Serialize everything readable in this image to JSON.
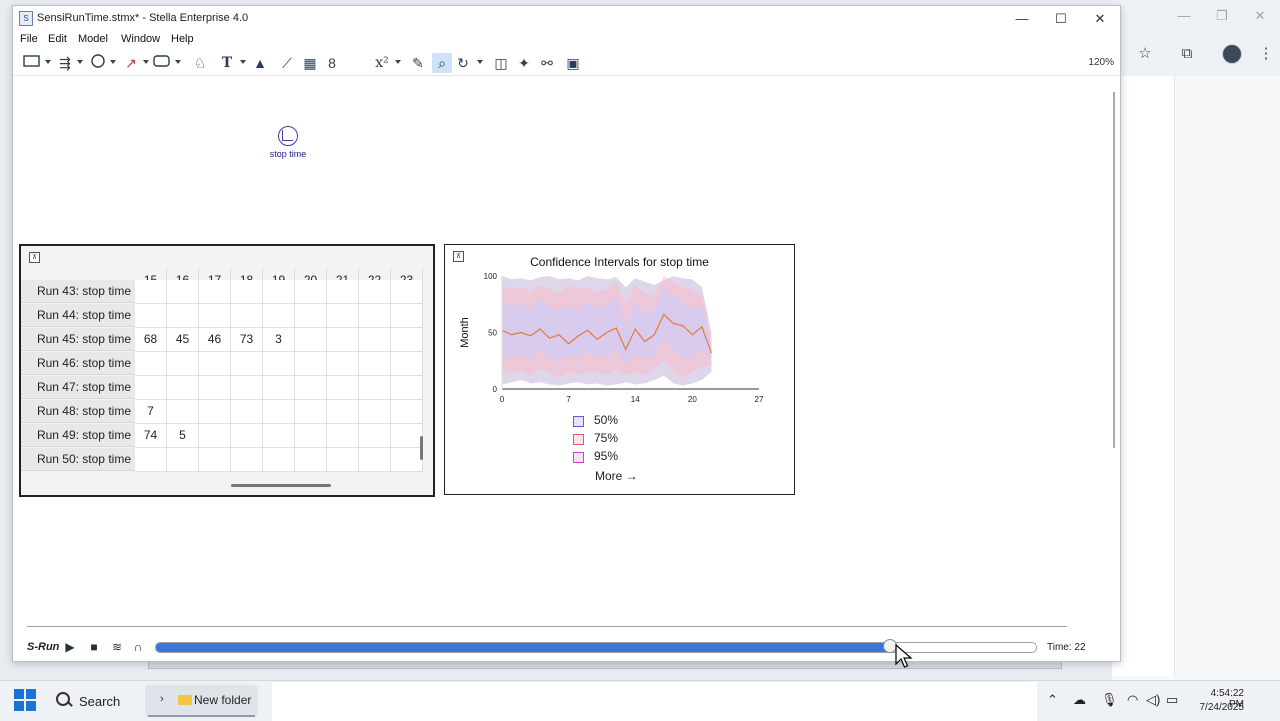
{
  "window": {
    "title": "SensiRunTime.stmx* - Stella Enterprise 4.0",
    "controls": {
      "minimize": "—",
      "maximize": "☐",
      "close": "✕"
    }
  },
  "menu": [
    "File",
    "Edit",
    "Model",
    "Window",
    "Help"
  ],
  "toolbar": {
    "zoom": "120%"
  },
  "canvas": {
    "converter_label": "stop time"
  },
  "table": {
    "columns": [
      "15",
      "16",
      "17",
      "18",
      "19",
      "20",
      "21",
      "22",
      "23"
    ],
    "rows": [
      {
        "label": "Run 43: stop time",
        "cells": [
          "",
          "",
          "",
          "",
          "",
          "",
          "",
          "",
          ""
        ]
      },
      {
        "label": "Run 44: stop time",
        "cells": [
          "",
          "",
          "",
          "",
          "",
          "",
          "",
          "",
          ""
        ]
      },
      {
        "label": "Run 45: stop time",
        "cells": [
          "68",
          "45",
          "46",
          "73",
          "3",
          "",
          "",
          "",
          ""
        ]
      },
      {
        "label": "Run 46: stop time",
        "cells": [
          "",
          "",
          "",
          "",
          "",
          "",
          "",
          "",
          ""
        ]
      },
      {
        "label": "Run 47: stop time",
        "cells": [
          "",
          "",
          "",
          "",
          "",
          "",
          "",
          "",
          ""
        ]
      },
      {
        "label": "Run 48: stop time",
        "cells": [
          "7",
          "",
          "",
          "",
          "",
          "",
          "",
          "",
          ""
        ]
      },
      {
        "label": "Run 49: stop time",
        "cells": [
          "74",
          "5",
          "",
          "",
          "",
          "",
          "",
          "",
          ""
        ]
      },
      {
        "label": "Run 50: stop time",
        "cells": [
          "",
          "",
          "",
          "",
          "",
          "",
          "",
          "",
          ""
        ]
      }
    ]
  },
  "chart": {
    "title": "Confidence Intervals for stop time",
    "ylabel": "Month",
    "legend": [
      {
        "label": "50%",
        "color": "#6a5acd"
      },
      {
        "label": "75%",
        "color": "#e05a6a"
      },
      {
        "label": "95%",
        "color": "#d040c8"
      }
    ],
    "more": "More →"
  },
  "chart_data": {
    "type": "area",
    "title": "Confidence Intervals for stop time",
    "ylabel": "Month",
    "xlim": [
      0,
      27
    ],
    "ylim": [
      0,
      100
    ],
    "xticks": [
      0,
      7,
      14,
      20,
      27
    ],
    "yticks": [
      0,
      50,
      100
    ],
    "x": [
      0,
      1,
      2,
      3,
      4,
      5,
      6,
      7,
      8,
      9,
      10,
      11,
      12,
      13,
      14,
      15,
      16,
      17,
      18,
      19,
      20,
      21,
      22
    ],
    "median": [
      52,
      48,
      50,
      47,
      53,
      45,
      48,
      40,
      47,
      52,
      44,
      50,
      54,
      35,
      53,
      42,
      48,
      66,
      58,
      56,
      48,
      55,
      32
    ],
    "band_95": {
      "low": [
        4,
        6,
        8,
        5,
        6,
        4,
        3,
        5,
        6,
        4,
        5,
        3,
        4,
        6,
        4,
        5,
        8,
        12,
        5,
        3,
        5,
        8,
        15
      ],
      "high": [
        100,
        97,
        98,
        96,
        99,
        100,
        97,
        98,
        96,
        100,
        98,
        97,
        99,
        90,
        98,
        95,
        92,
        96,
        100,
        98,
        97,
        90,
        50
      ]
    },
    "band_75": {
      "low": [
        15,
        14,
        16,
        12,
        18,
        14,
        10,
        15,
        12,
        16,
        14,
        12,
        18,
        12,
        15,
        12,
        18,
        25,
        15,
        10,
        15,
        20,
        20
      ],
      "high": [
        92,
        88,
        90,
        86,
        92,
        88,
        85,
        92,
        88,
        90,
        86,
        88,
        95,
        75,
        92,
        85,
        82,
        100,
        95,
        90,
        88,
        82,
        42
      ]
    },
    "band_50": {
      "low": [
        30,
        28,
        32,
        26,
        34,
        28,
        24,
        30,
        28,
        32,
        28,
        30,
        35,
        20,
        32,
        26,
        30,
        45,
        32,
        28,
        30,
        35,
        26
      ],
      "high": [
        78,
        72,
        76,
        70,
        80,
        72,
        70,
        74,
        70,
        78,
        72,
        74,
        82,
        55,
        78,
        68,
        70,
        90,
        82,
        78,
        72,
        72,
        38
      ]
    },
    "series": [
      {
        "name": "50%",
        "color": "#6a5acd"
      },
      {
        "name": "75%",
        "color": "#e05a6a"
      },
      {
        "name": "95%",
        "color": "#d040c8"
      }
    ],
    "legend": "bottom-center",
    "grid": false
  },
  "runbar": {
    "label": "S-Run",
    "progress_fraction": 0.834,
    "time": "Time: 22"
  },
  "taskbar": {
    "search": "Search",
    "folder": "New folder",
    "time": "4:54:22 PM",
    "date": "7/24/2025"
  }
}
